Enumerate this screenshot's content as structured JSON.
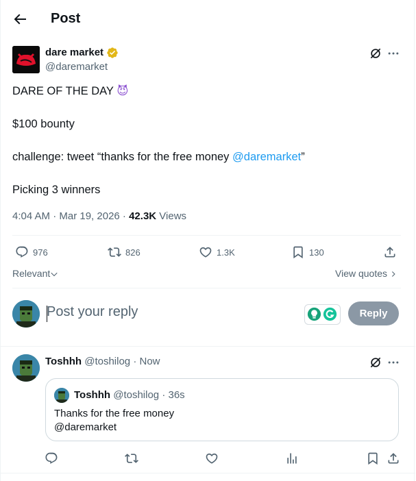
{
  "header": {
    "title": "Post"
  },
  "post": {
    "author_name": "dare market",
    "author_handle": "@daremarket",
    "line1": "DARE OF THE DAY",
    "emoji": "😈",
    "line2": "$100 bounty",
    "line3_prefix": "challenge: tweet “thanks for the free money ",
    "line3_mention": "@daremarket",
    "line3_suffix": "”",
    "line4": "Picking 3 winners",
    "time": "4:04 AM · Mar 19, 2026 · ",
    "views_count": "42.3K",
    "views_label": " Views",
    "stats": {
      "replies": "976",
      "reposts": "826",
      "likes": "1.3K",
      "bookmarks": "130"
    }
  },
  "sort": {
    "label": "Relevant",
    "view_quotes": "View quotes"
  },
  "composer": {
    "placeholder": "Post your reply",
    "reply_label": "Reply"
  },
  "reply": {
    "author_name": "Toshhh",
    "author_handle": "@toshilog",
    "time": " · Now",
    "quote": {
      "author_name": "Toshhh",
      "author_handle": "@toshilog",
      "time": " · 36s",
      "text_line1": "Thanks for the free money",
      "text_line2": "@daremarket"
    }
  },
  "colors": {
    "accent": "#1d9bf0",
    "verified": "#e2b719",
    "button_disabled": "#8b98a5"
  },
  "icons": [
    "back-arrow-icon",
    "verified-badge-icon",
    "grok-icon",
    "more-icon",
    "reply-icon",
    "repost-icon",
    "like-icon",
    "bookmark-icon",
    "share-icon",
    "chevron-down-icon",
    "chevron-right-icon",
    "views-icon"
  ]
}
